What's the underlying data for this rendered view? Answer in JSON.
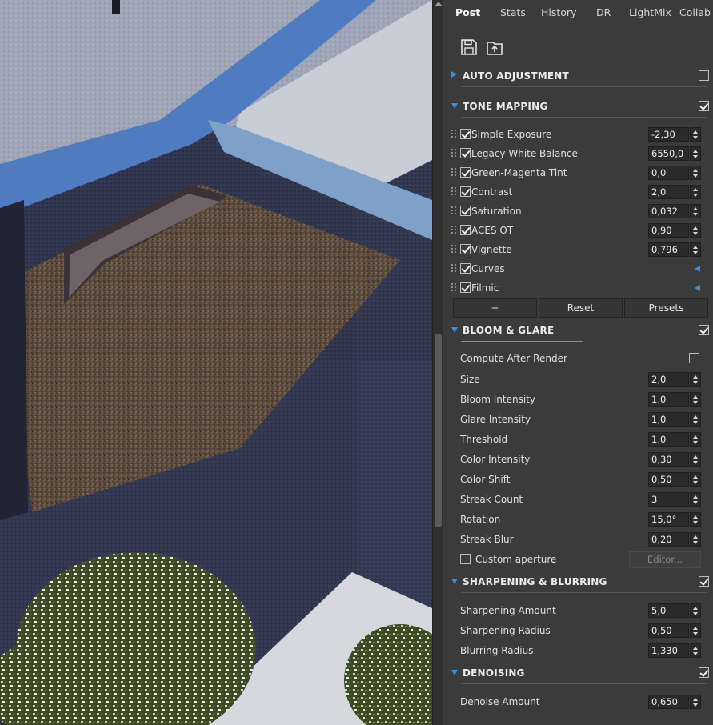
{
  "tabs": [
    {
      "label": "Post",
      "active": true
    },
    {
      "label": "Stats",
      "active": false
    },
    {
      "label": "History",
      "active": false
    },
    {
      "label": "DR",
      "active": false
    },
    {
      "label": "LightMix",
      "active": false
    },
    {
      "label": "Collab",
      "active": false
    }
  ],
  "toolbar": {
    "icons": [
      "save-icon",
      "load-icon"
    ]
  },
  "sections": {
    "auto_adjustment": {
      "title": "AUTO ADJUSTMENT",
      "expanded": false,
      "enabled": false
    },
    "tone_mapping": {
      "title": "TONE MAPPING",
      "expanded": true,
      "enabled": true
    },
    "bloom_glare": {
      "title": "BLOOM & GLARE",
      "expanded": true,
      "enabled": true
    },
    "sharpening": {
      "title": "SHARPENING & BLURRING",
      "expanded": true,
      "enabled": true
    },
    "denoising": {
      "title": "DENOISING",
      "expanded": true,
      "enabled": true
    }
  },
  "tone_mapping_items": [
    {
      "label": "Simple Exposure",
      "value": "-2,30",
      "enabled": true
    },
    {
      "label": "Legacy White Balance",
      "value": "6550,0",
      "enabled": true
    },
    {
      "label": "Green-Magenta Tint",
      "value": "0,0",
      "enabled": true
    },
    {
      "label": "Contrast",
      "value": "2,0",
      "enabled": true
    },
    {
      "label": "Saturation",
      "value": "0,032",
      "enabled": true
    },
    {
      "label": "ACES OT",
      "value": "0,90",
      "enabled": true
    },
    {
      "label": "Vignette",
      "value": "0,796",
      "enabled": true
    },
    {
      "label": "Curves",
      "enabled": true,
      "expandable": true
    },
    {
      "label": "Filmic",
      "enabled": true,
      "expandable": true
    }
  ],
  "tone_mapping_buttons": {
    "add": "+",
    "reset": "Reset",
    "presets": "Presets"
  },
  "bloom_items": {
    "compute_after_render": {
      "label": "Compute After Render",
      "checked": false
    },
    "params": [
      {
        "label": "Size",
        "value": "2,0"
      },
      {
        "label": "Bloom Intensity",
        "value": "1,0"
      },
      {
        "label": "Glare Intensity",
        "value": "1,0"
      },
      {
        "label": "Threshold",
        "value": "1,0"
      },
      {
        "label": "Color Intensity",
        "value": "0,30"
      },
      {
        "label": "Color Shift",
        "value": "0,50"
      },
      {
        "label": "Streak Count",
        "value": "3"
      },
      {
        "label": "Rotation",
        "value": "15,0°"
      },
      {
        "label": "Streak Blur",
        "value": "0,20"
      }
    ],
    "custom_aperture": {
      "label": "Custom aperture",
      "checked": false,
      "editor_label": "Editor..."
    }
  },
  "sharpening_items": [
    {
      "label": "Sharpening Amount",
      "value": "5,0"
    },
    {
      "label": "Sharpening Radius",
      "value": "0,50"
    },
    {
      "label": "Blurring Radius",
      "value": "1,330"
    }
  ],
  "denoising_items": [
    {
      "label": "Denoise Amount",
      "value": "0,650"
    }
  ],
  "colors": {
    "accent": "#3b8de0",
    "panel_bg": "#3b3b3b",
    "field_bg": "#2a2a2a"
  }
}
